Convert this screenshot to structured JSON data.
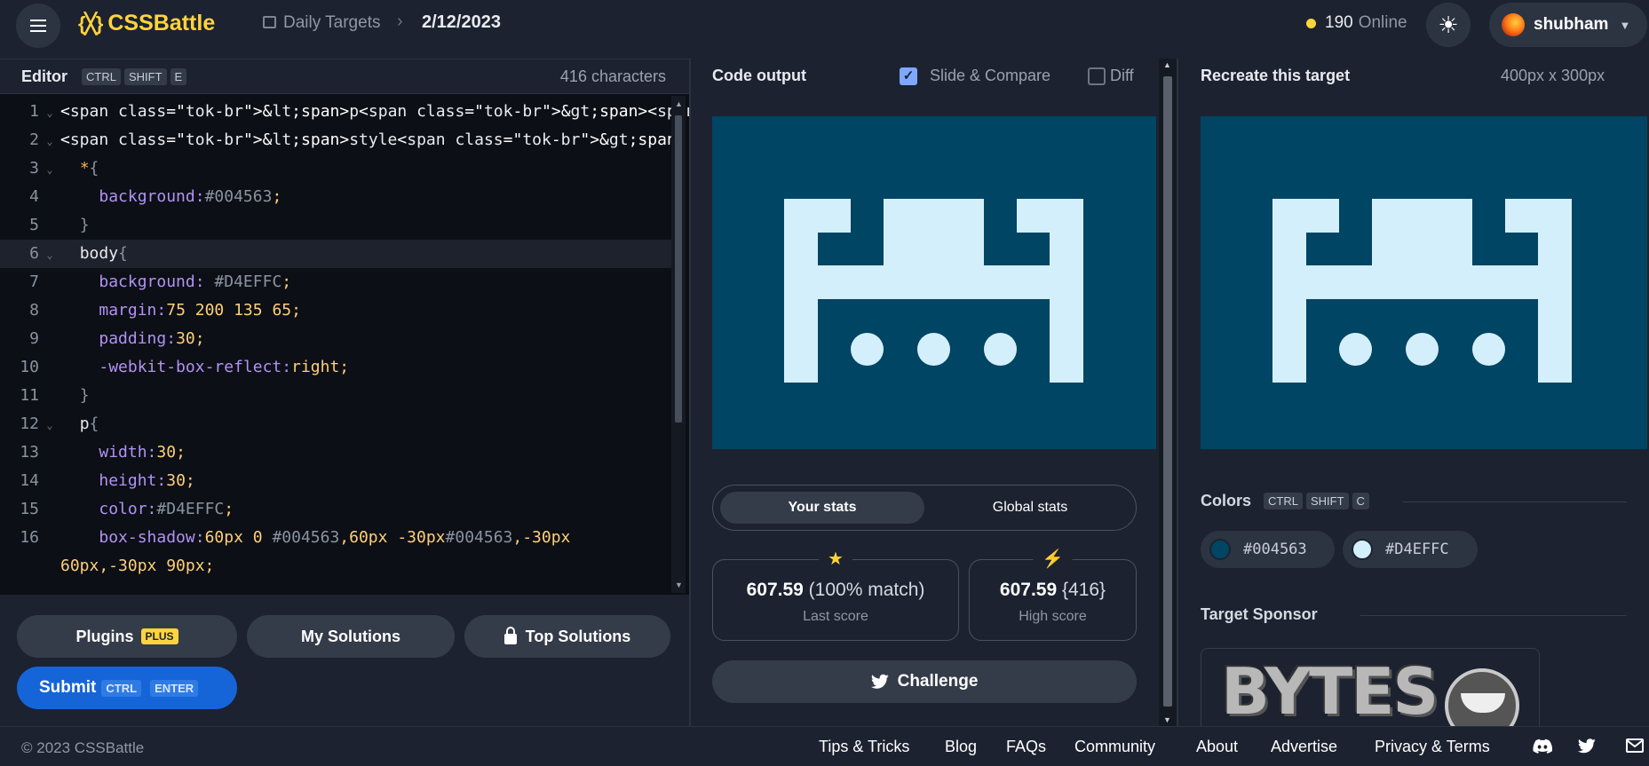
{
  "header": {
    "logo": "CSSBattle",
    "logo_mark": "{╳}",
    "crumb_link": "Daily Targets",
    "crumb_date": "2/12/2023",
    "online_count": "190",
    "online_label": "Online",
    "user_name": "shubham"
  },
  "editor": {
    "title": "Editor",
    "shortcut": [
      "CTRL",
      "SHIFT",
      "E"
    ],
    "char_count": "416 characters"
  },
  "buttons": {
    "plugins": "Plugins",
    "plus_badge": "PLUS",
    "my_solutions": "My Solutions",
    "top_solutions": "Top Solutions",
    "submit": "Submit",
    "submit_keys": [
      "CTRL",
      "ENTER"
    ]
  },
  "output": {
    "title": "Code output",
    "slide_compare": "Slide & Compare",
    "diff": "Diff",
    "tab_your": "Your stats",
    "tab_global": "Global stats",
    "last_score_val": "607.59",
    "last_score_extra": "(100% match)",
    "last_score_lbl": "Last score",
    "high_score_val": "607.59",
    "high_score_extra": "{416}",
    "high_score_lbl": "High score",
    "challenge": "Challenge"
  },
  "target": {
    "title": "Recreate this target",
    "size": "400px x 300px",
    "colors_title": "Colors",
    "colors_keys": [
      "CTRL",
      "SHIFT",
      "C"
    ],
    "color1": "#004563",
    "color2": "#D4EFFC",
    "sponsor_title": "Target Sponsor",
    "sponsor_name": "BYTES"
  },
  "footer": {
    "copyright": "© 2023 CSSBattle",
    "links": [
      "Tips & Tricks",
      "Blog",
      "FAQs",
      "Community",
      "About",
      "Advertise",
      "Privacy & Terms"
    ]
  },
  "code": [
    {
      "n": "1",
      "text": "<p><p a>"
    },
    {
      "n": "2",
      "text": "<style>"
    },
    {
      "n": "3",
      "text": "  *{"
    },
    {
      "n": "4",
      "text": "    background:#004563;"
    },
    {
      "n": "5",
      "text": "  }"
    },
    {
      "n": "6",
      "text": "  body{"
    },
    {
      "n": "7",
      "text": "    background: #D4EFFC;"
    },
    {
      "n": "8",
      "text": "    margin:75 200 135 65;"
    },
    {
      "n": "9",
      "text": "    padding:30;"
    },
    {
      "n": "10",
      "text": "    -webkit-box-reflect:right;"
    },
    {
      "n": "11",
      "text": "  }"
    },
    {
      "n": "12",
      "text": "  p{"
    },
    {
      "n": "13",
      "text": "    width:30;"
    },
    {
      "n": "14",
      "text": "    height:30;"
    },
    {
      "n": "15",
      "text": "    color:#D4EFFC;"
    },
    {
      "n": "16",
      "text": "    box-shadow:60px 0 #004563,60px -30px#004563,-30px"
    },
    {
      "n": "",
      "text": "60px,-30px 90px;"
    }
  ],
  "colors": {
    "accent": "#ffd43b",
    "submit": "#1565d8",
    "bg": "#004563",
    "fg": "#D4EFFC"
  }
}
